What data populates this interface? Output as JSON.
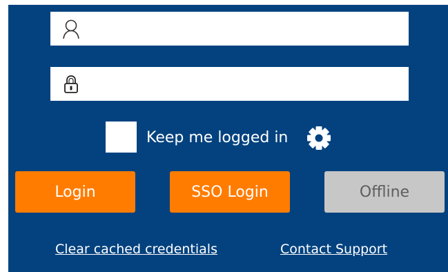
{
  "form": {
    "username": {
      "value": "",
      "placeholder": ""
    },
    "password": {
      "value": "",
      "placeholder": ""
    },
    "keep_logged_in": {
      "label": "Keep me logged in",
      "checked": false
    }
  },
  "buttons": {
    "login": "Login",
    "sso_login": "SSO Login",
    "offline": "Offline"
  },
  "links": {
    "clear_cache": "Clear cached credentials",
    "contact_support": "Contact Support"
  },
  "icons": {
    "username": "user-icon",
    "password": "lock-icon",
    "settings": "gear-icon"
  },
  "colors": {
    "panel_background": "#03427f",
    "primary_button": "#ff7c00",
    "disabled_button": "#c7c7c7",
    "disabled_text": "#5e5e5e"
  }
}
